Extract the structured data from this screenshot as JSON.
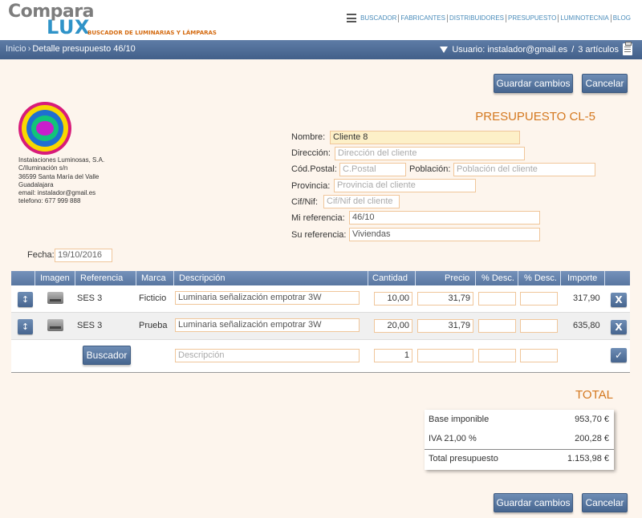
{
  "brand": {
    "name_part1": "Compara",
    "name_part2": "LUX",
    "tagline": "BUSCADOR DE LUMINARIAS Y LÁMPARAS",
    "color_primary": "#2f93c8",
    "color_accent": "#d46a10"
  },
  "nav": {
    "menu_icon": "hamburger-icon",
    "items": [
      "BUSCADOR",
      "FABRICANTES",
      "DISTRIBUIDORES",
      "PRESUPUESTO",
      "LUMINOTECNIA",
      "BLOG"
    ]
  },
  "breadcrumb": {
    "home": "Inicio",
    "separator": "›",
    "current": "Detalle presupuesto 46/10"
  },
  "user": {
    "label": "Usuario: instalador@gmail.es",
    "separator": "/",
    "cart": "3 artículos"
  },
  "actions": {
    "save": "Guardar cambios",
    "cancel": "Cancelar"
  },
  "quote": {
    "title": "PRESUPUESTO CL-5",
    "date_label": "Fecha:",
    "date_value": "19/10/2016"
  },
  "company": {
    "lines": [
      "Instalaciones Luminosas, S.A.",
      "C/Iluminación s/n",
      "36599 Santa María del Valle",
      "Guadalajara",
      "email: instalador@gmail.es",
      "telefono: 677 999 888"
    ]
  },
  "client": {
    "name_label": "Nombre:",
    "name_value": "Cliente 8",
    "address_label": "Dirección:",
    "address_placeholder": "Dirección del cliente",
    "zip_label": "Cód.Postal:",
    "zip_placeholder": "C.Postal",
    "city_label": "Población:",
    "city_placeholder": "Población del cliente",
    "province_label": "Provincia:",
    "province_placeholder": "Provincia del cliente",
    "cif_label": "Cif/Nif:",
    "cif_placeholder": "Cif/Nif del cliente",
    "myref_label": "Mi referencia:",
    "myref_value": "46/10",
    "yourref_label": "Su referencia:",
    "yourref_value": "Viviendas"
  },
  "table": {
    "headers": [
      "Imagen",
      "Referencia",
      "Marca",
      "Descripción",
      "Cantidad",
      "Precio",
      "% Desc.",
      "% Desc.",
      "Importe"
    ],
    "rows": [
      {
        "reference": "SES 3",
        "brand": "Ficticio",
        "description": "Luminaria señalización empotrar 3W",
        "quantity": "10,00",
        "price": "31,79",
        "discount1": "",
        "discount2": "",
        "amount": "317,90"
      },
      {
        "reference": "SES 3",
        "brand": "Prueba",
        "description": "Luminaria señalización empotrar 3W",
        "quantity": "20,00",
        "price": "31,79",
        "discount1": "",
        "discount2": "",
        "amount": "635,80"
      }
    ],
    "new_row": {
      "search_button": "Buscador",
      "description_placeholder": "Descripción",
      "quantity_value": "1"
    },
    "move_glyph": "↕",
    "delete_glyph": "X",
    "confirm_glyph": "✓"
  },
  "totals": {
    "title": "TOTAL",
    "base_label": "Base imponible",
    "base_value": "953,70 €",
    "vat_label": "IVA 21,00 %",
    "vat_value": "200,28 €",
    "total_label": "Total presupuesto",
    "total_value": "1.153,98 €"
  }
}
